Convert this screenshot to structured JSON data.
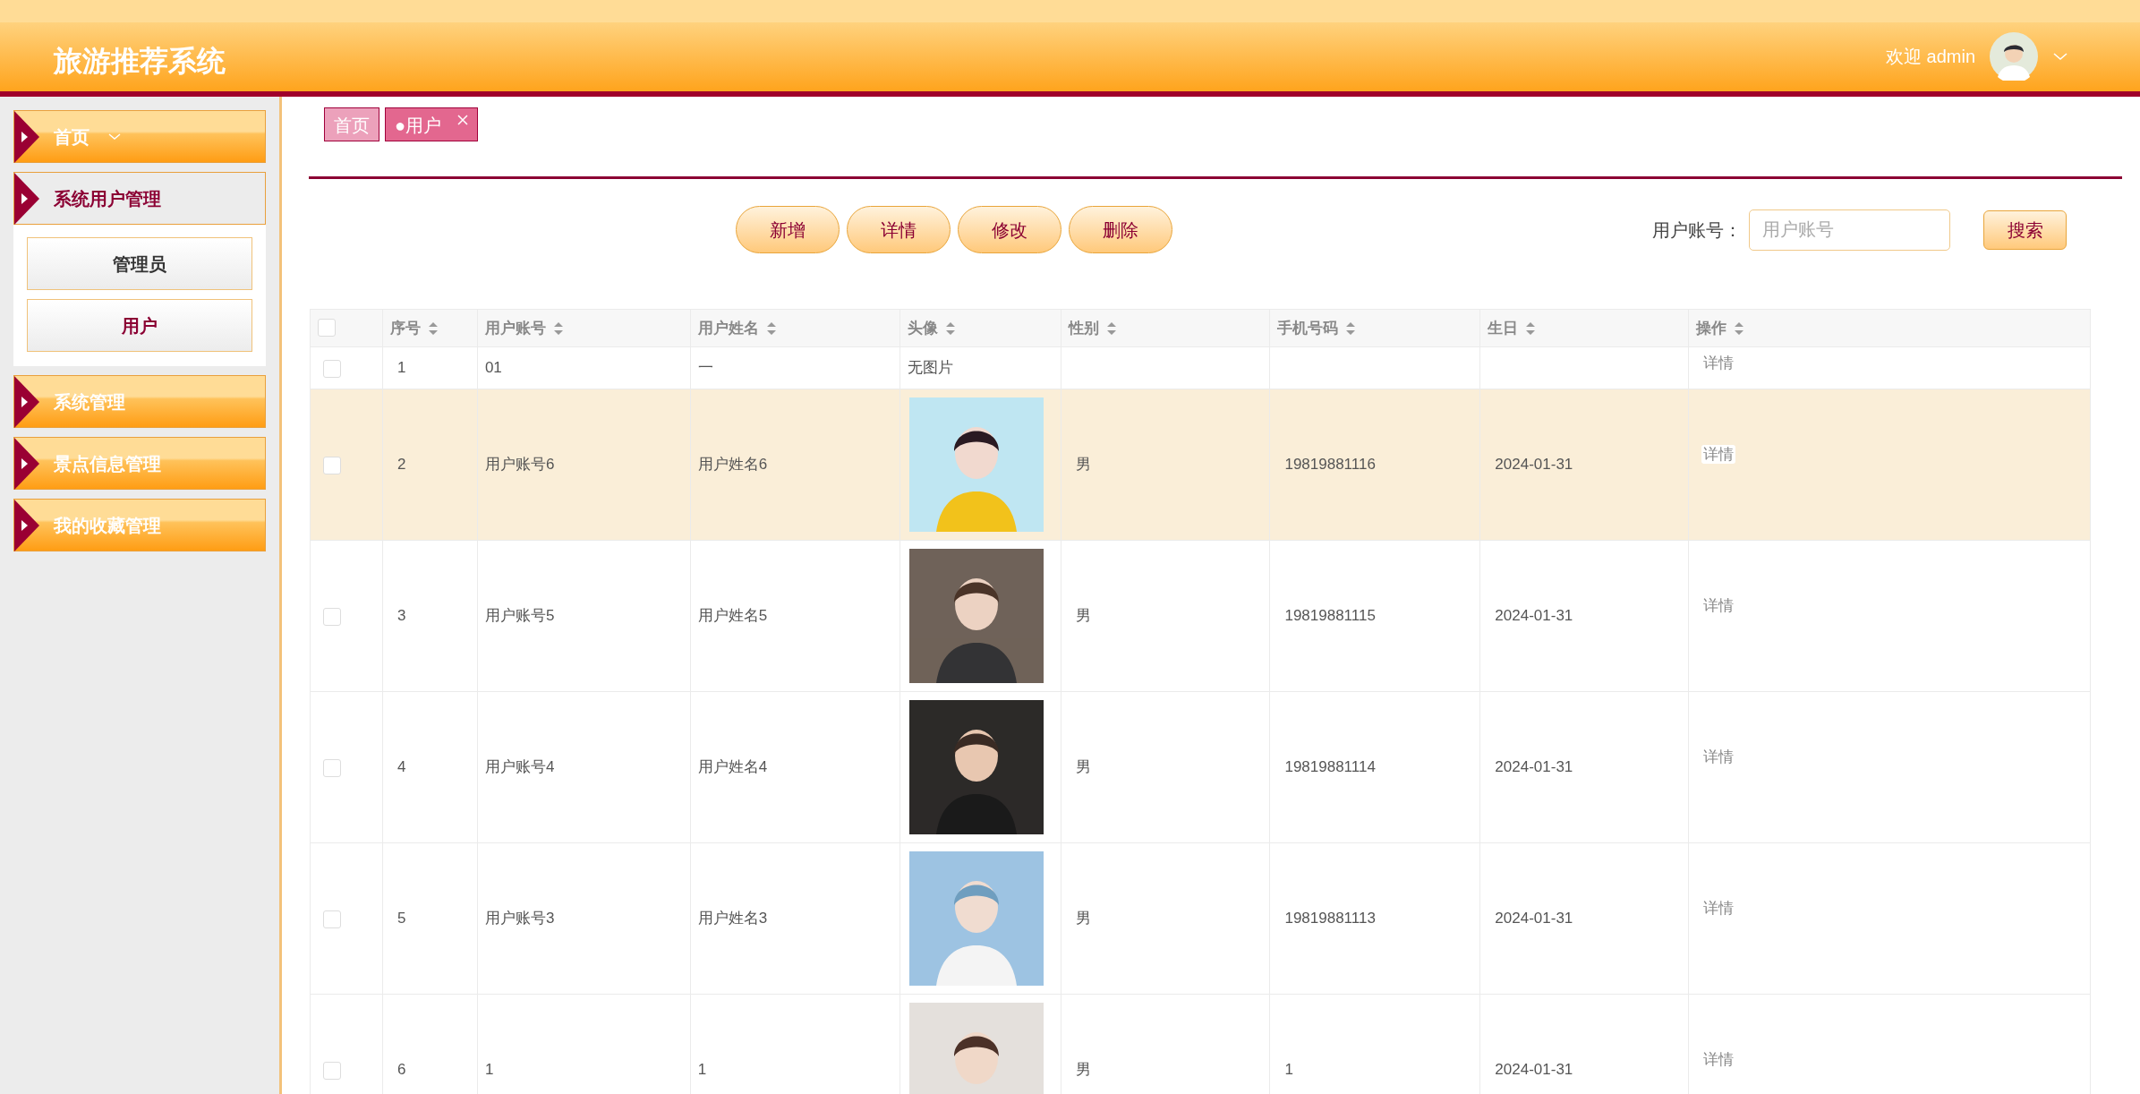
{
  "header": {
    "title": "旅游推荐系统",
    "welcome": "欢迎 admin"
  },
  "sidebar": {
    "items": [
      {
        "label": "首页",
        "chevron": true,
        "expanded": false
      },
      {
        "label": "系统用户管理",
        "chevron": false,
        "expanded": true,
        "children": [
          {
            "label": "管理员",
            "selected": false
          },
          {
            "label": "用户",
            "selected": true
          }
        ]
      },
      {
        "label": "系统管理",
        "chevron": false,
        "expanded": false
      },
      {
        "label": "景点信息管理",
        "chevron": false,
        "expanded": false
      },
      {
        "label": "我的收藏管理",
        "chevron": false,
        "expanded": false
      }
    ]
  },
  "tabs": [
    {
      "label": "首页",
      "selected": false,
      "closable": false
    },
    {
      "label": "●用户",
      "selected": true,
      "closable": true
    }
  ],
  "toolbar": {
    "buttons": [
      "新增",
      "详情",
      "修改",
      "删除"
    ],
    "search_label": "用户账号：",
    "search": {
      "placeholder": "用户账号"
    },
    "search_button": "搜索"
  },
  "table": {
    "columns": [
      {
        "label": "序号",
        "sortable": true
      },
      {
        "label": "用户账号",
        "sortable": true
      },
      {
        "label": "用户姓名",
        "sortable": true
      },
      {
        "label": "头像",
        "sortable": true
      },
      {
        "label": "性别",
        "sortable": true
      },
      {
        "label": "手机号码",
        "sortable": true
      },
      {
        "label": "生日",
        "sortable": true
      },
      {
        "label": "操作",
        "sortable": true
      }
    ],
    "header_checked": false,
    "rows": [
      {
        "selected": false,
        "checked": false,
        "cells": [
          "1",
          "01",
          "一",
          {
            "kind": "text",
            "text": "无图片"
          },
          "",
          "",
          "",
          {
            "kind": "action",
            "text": "详情"
          }
        ]
      },
      {
        "selected": true,
        "checked": false,
        "cells": [
          "2",
          "用户账号6",
          "用户姓名6",
          {
            "kind": "picture"
          },
          "男",
          "19819881116",
          "2024-01-31",
          {
            "kind": "action",
            "text": "详情"
          }
        ]
      },
      {
        "selected": false,
        "checked": false,
        "cells": [
          "3",
          "用户账号5",
          "用户姓名5",
          {
            "kind": "picture"
          },
          "男",
          "19819881115",
          "2024-01-31",
          {
            "kind": "action",
            "text": "详情"
          }
        ]
      },
      {
        "selected": false,
        "checked": false,
        "cells": [
          "4",
          "用户账号4",
          "用户姓名4",
          {
            "kind": "picture"
          },
          "男",
          "19819881114",
          "2024-01-31",
          {
            "kind": "action",
            "text": "详情"
          }
        ]
      },
      {
        "selected": false,
        "checked": false,
        "cells": [
          "5",
          "用户账号3",
          "用户姓名3",
          {
            "kind": "picture"
          },
          "男",
          "19819881113",
          "2024-01-31",
          {
            "kind": "action",
            "text": "详情"
          }
        ]
      },
      {
        "selected": false,
        "checked": false,
        "cells": [
          "6",
          "1",
          "1",
          {
            "kind": "picture"
          },
          "男",
          "1",
          "2024-01-31",
          {
            "kind": "action",
            "text": "详情"
          }
        ]
      }
    ]
  }
}
